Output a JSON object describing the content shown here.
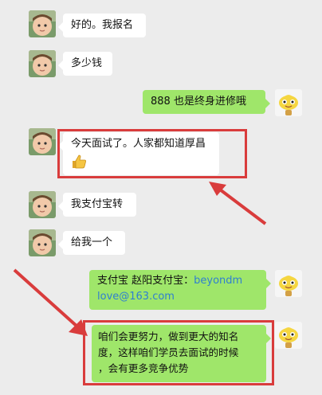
{
  "messages": [
    {
      "side": "left",
      "text": "好的。我报名"
    },
    {
      "side": "left",
      "text": "多少钱"
    },
    {
      "side": "right",
      "text": "888   也是终身进修哦"
    },
    {
      "side": "left",
      "text": "今天面试了。人家都知道厚昌",
      "emoji": "thumbs-up-icon"
    },
    {
      "side": "left",
      "text": "我支付宝转"
    },
    {
      "side": "left",
      "text": "给我一个"
    },
    {
      "side": "right",
      "text_prefix": "支付宝   赵阳支付宝：",
      "link_line1": "beyondm",
      "link_line2": "love@163.com"
    },
    {
      "side": "right",
      "line1": "咱们会更努力，做到更大的知名",
      "line2": "度，这样咱们学员去面试的时候",
      "line3": "，会有更多竞争优势"
    }
  ],
  "colors": {
    "background": "#ececec",
    "left_bubble": "#ffffff",
    "right_bubble": "#9fe66a",
    "highlight": "#d93c3c",
    "link": "#2f7fd0"
  }
}
